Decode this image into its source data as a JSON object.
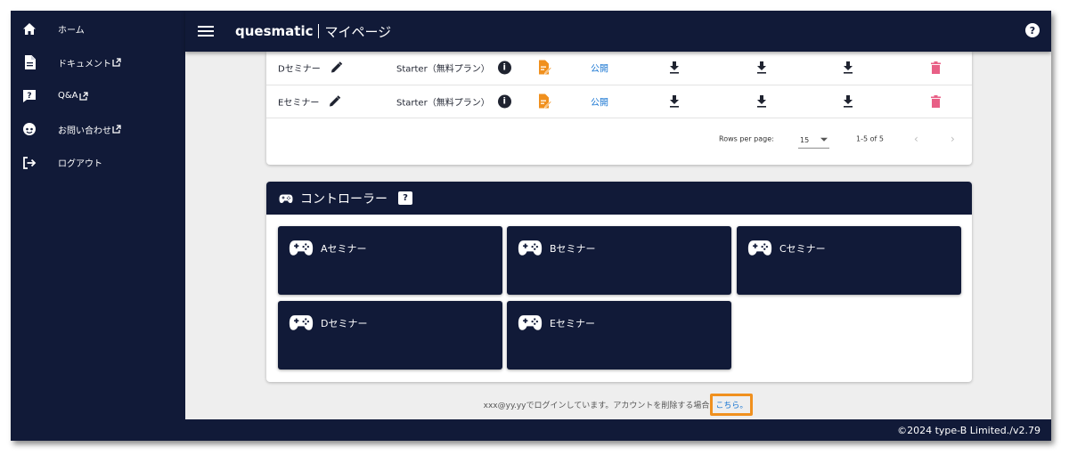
{
  "sidebar": {
    "items": [
      {
        "label": "ホーム",
        "icon": "home-icon"
      },
      {
        "label": "ドキュメント",
        "icon": "document-icon",
        "external": true
      },
      {
        "label": "Q&A",
        "icon": "question-icon",
        "external": true
      },
      {
        "label": "お問い合わせ",
        "icon": "support-icon",
        "external": true
      },
      {
        "label": "ログアウト",
        "icon": "logout-icon"
      }
    ]
  },
  "header": {
    "brand": "quesmatic",
    "title": "マイページ",
    "help_icon": "help-icon",
    "help_label": "?"
  },
  "seminar_table": {
    "rows": [
      {
        "name": "Dセミナー",
        "plan": "Starter（無料プラン）",
        "status": "公開"
      },
      {
        "name": "Eセミナー",
        "plan": "Starter（無料プラン）",
        "status": "公開"
      }
    ],
    "info_label": "i",
    "pagination": {
      "rows_per_page_label": "Rows per page:",
      "rows_per_page_value": "15",
      "range": "1-5 of 5",
      "prev": "‹",
      "next": "›"
    }
  },
  "controller": {
    "title": "コントローラー",
    "help_label": "?",
    "tiles": [
      "Aセミナー",
      "Bセミナー",
      "Cセミナー",
      "Dセミナー",
      "Eセミナー"
    ]
  },
  "footer": {
    "note": "xxx@yy.yyでログインしています。アカウントを削除する場合",
    "link": "こちら。",
    "copyright": "©2024 type-B Limited./v2.79"
  },
  "colors": {
    "navy": "#111a38",
    "accent_orange": "#f0901e",
    "delete_pink": "#e85f86",
    "link_blue": "#1976d2"
  }
}
